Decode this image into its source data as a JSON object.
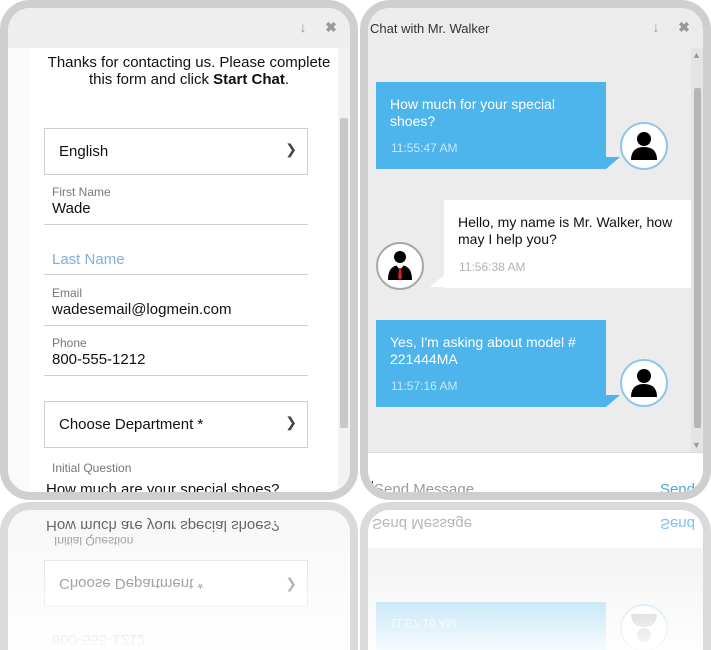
{
  "form": {
    "intro_text": "Thanks for contacting us. Please complete this form and click",
    "intro_bold": "Start Chat",
    "intro_end": ".",
    "language": "English",
    "first_name_label": "First Name",
    "first_name_value": "Wade",
    "last_name_placeholder": "Last Name",
    "email_label": "Email",
    "email_value": "wadesemail@logmein.com",
    "phone_label": "Phone",
    "phone_value": "800-555-1212",
    "department": "Choose Department *",
    "initial_question_label": "Initial Question",
    "initial_question_value": "How much are your special shoes?"
  },
  "chat": {
    "title": "Chat with Mr. Walker",
    "messages": [
      {
        "from": "visitor",
        "text": "How much for your special shoes?",
        "time": "11:55:47 AM"
      },
      {
        "from": "agent",
        "text": "Hello, my name is Mr. Walker, how may I help you?",
        "time": "11:56:38 AM"
      },
      {
        "from": "visitor",
        "text": "Yes, I'm asking about model # 221444MA",
        "time": "11:57:16 AM"
      }
    ],
    "send_placeholder": "Send Message",
    "send_label": "Send"
  },
  "colors": {
    "visitor_bubble": "#4db4ec",
    "agent_bubble": "#ffffff",
    "frame": "#cfcfcf",
    "link": "#4aa7dc"
  },
  "icons": {
    "minimize": "down-arrow-icon",
    "close": "close-x-icon",
    "dropdown": "chevron-down-icon",
    "visitor_avatar": "user-silhouette-icon",
    "agent_avatar": "agent-suit-icon"
  }
}
